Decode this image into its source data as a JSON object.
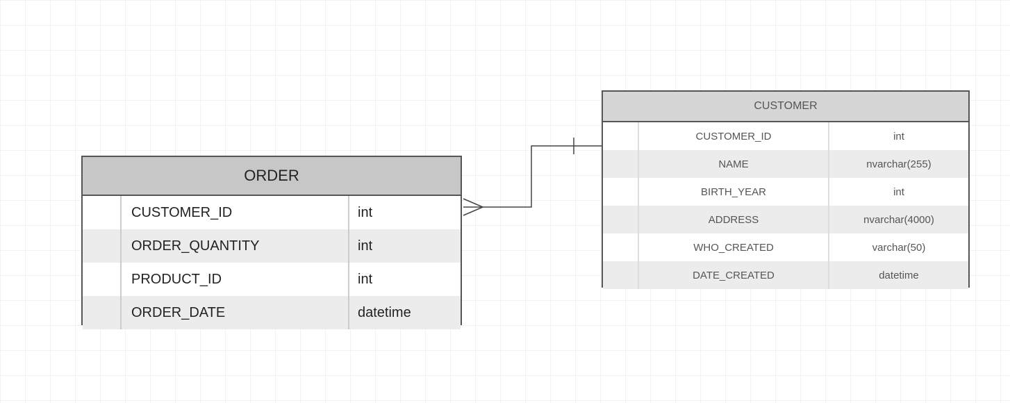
{
  "entities": {
    "order": {
      "title": "ORDER",
      "columns": [
        {
          "name": "CUSTOMER_ID",
          "type": "int"
        },
        {
          "name": "ORDER_QUANTITY",
          "type": "int"
        },
        {
          "name": "PRODUCT_ID",
          "type": "int"
        },
        {
          "name": "ORDER_DATE",
          "type": "datetime"
        }
      ]
    },
    "customer": {
      "title": "CUSTOMER",
      "columns": [
        {
          "name": "CUSTOMER_ID",
          "type": "int"
        },
        {
          "name": "NAME",
          "type": "nvarchar(255)"
        },
        {
          "name": "BIRTH_YEAR",
          "type": "int"
        },
        {
          "name": "ADDRESS",
          "type": "nvarchar(4000)"
        },
        {
          "name": "WHO_CREATED",
          "type": "varchar(50)"
        },
        {
          "name": "DATE_CREATED",
          "type": "datetime"
        }
      ]
    }
  },
  "relationship": {
    "from": "order",
    "to": "customer",
    "cardinality_from": "many",
    "cardinality_to": "one"
  }
}
